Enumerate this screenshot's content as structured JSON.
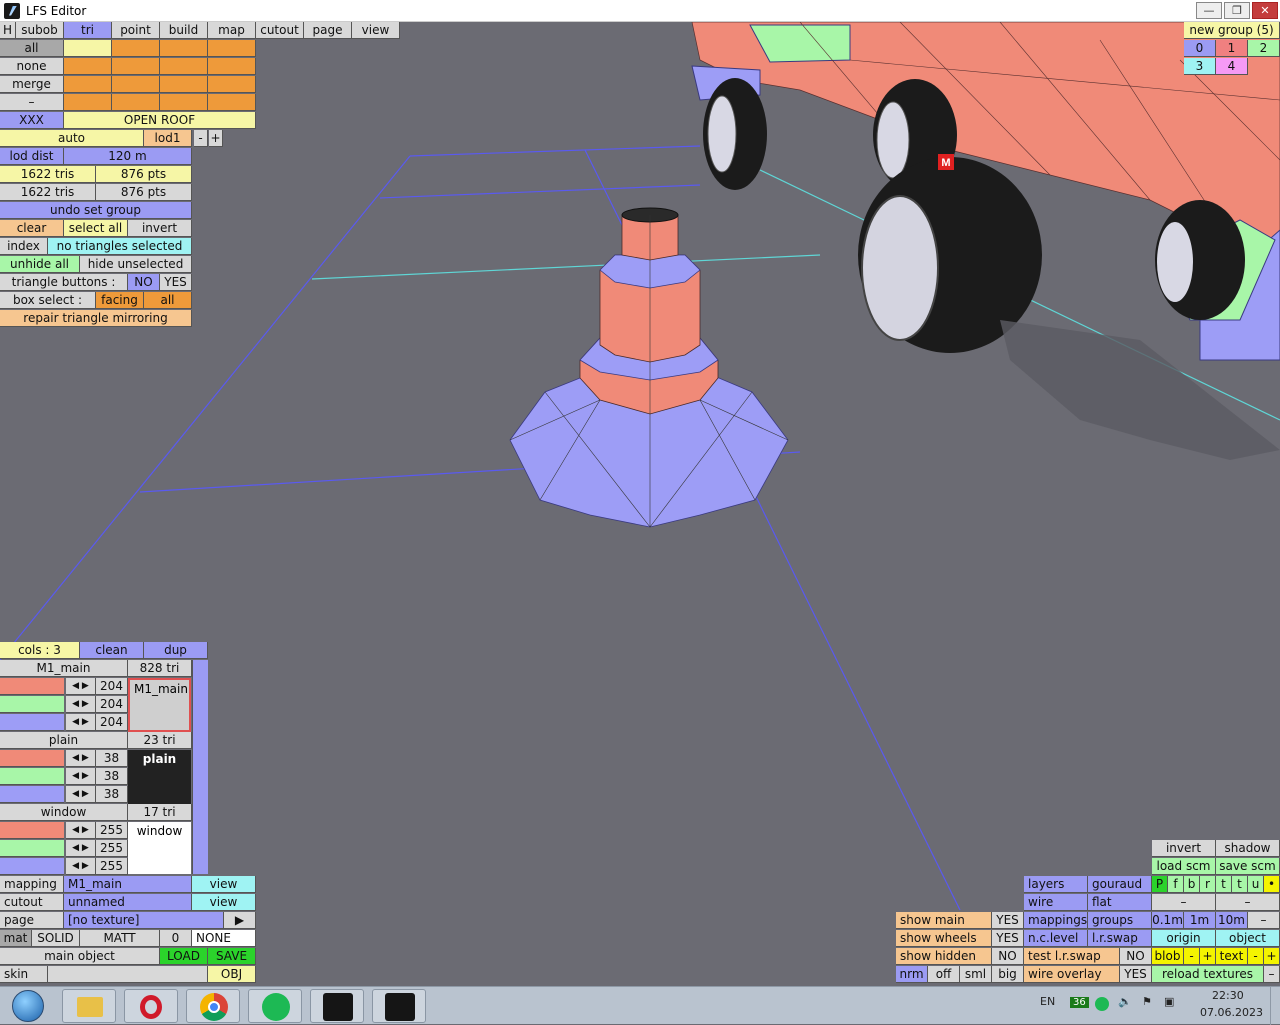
{
  "window": {
    "title": "LFS Editor",
    "min": "—",
    "max": "❐",
    "close": "✕"
  },
  "menu": {
    "h": "H",
    "items": [
      "subob",
      "tri",
      "point",
      "build",
      "map",
      "cutout",
      "page",
      "view"
    ]
  },
  "sel": {
    "all": "all",
    "none": "none",
    "merge": "merge",
    "dash": "–",
    "xxx": "XXX",
    "open_roof": "OPEN ROOF"
  },
  "lod": {
    "auto": "auto",
    "lod1": "lod1",
    "minus": "-",
    "plus": "+",
    "dist_label": "lod dist",
    "dist": "120 m"
  },
  "counts": {
    "tris1": "1622 tris",
    "pts1": "876 pts",
    "tris2": "1622 tris",
    "pts2": "876 pts"
  },
  "actions": {
    "undo": "undo set group",
    "clear": "clear",
    "select_all": "select all",
    "invert": "invert",
    "index": "index",
    "index_value": "no triangles selected",
    "unhide": "unhide all",
    "hide_unsel": "hide unselected",
    "tri_buttons": "triangle buttons :",
    "no": "NO",
    "yes": "YES",
    "box_select": "box select :",
    "facing": "facing",
    "all": "all",
    "repair": "repair triangle mirroring"
  },
  "group": {
    "new": "new group (5)",
    "n": [
      "0",
      "1",
      "2",
      "3",
      "4"
    ]
  },
  "cols": {
    "cols": "cols : 3",
    "clean": "clean",
    "dup": "dup"
  },
  "materials": [
    {
      "name": "M1_main",
      "tri": "828 tri",
      "vals": [
        "204",
        "204",
        "204"
      ],
      "preview": "M1_main"
    },
    {
      "name": "plain",
      "tri": "23 tri",
      "vals": [
        "38",
        "38",
        "38"
      ],
      "preview": "plain"
    },
    {
      "name": "window",
      "tri": "17 tri",
      "vals": [
        "255",
        "255",
        "255"
      ],
      "preview": "window"
    }
  ],
  "map": {
    "mapping": "mapping",
    "mapping_val": "M1_main",
    "view": "view",
    "cutout": "cutout",
    "cutout_val": "unnamed",
    "page": "page",
    "page_val": "[no texture]",
    "play": "▶",
    "mat": "mat",
    "solid": "SOLID",
    "matt": "MATT",
    "zero": "0",
    "none": "NONE",
    "main_object": "main object",
    "load": "LOAD",
    "save": "SAVE",
    "skin": "skin",
    "obj": "OBJ"
  },
  "view": {
    "show_main": "show main",
    "yes": "YES",
    "show_wheels": "show wheels",
    "show_hidden": "show hidden",
    "no": "NO",
    "nrm": "nrm",
    "off": "off",
    "sml": "sml",
    "big": "big",
    "layers": "layers",
    "gouraud": "gouraud",
    "wire": "wire",
    "flat": "flat",
    "mappings": "mappings",
    "groups": "groups",
    "nc_level": "n.c.level",
    "lr_swap": "l.r.swap",
    "test_lr": "test l.r.swap",
    "wire_overlay": "wire overlay",
    "invert": "invert",
    "shadow": "shadow",
    "load_scm": "load scm",
    "save_scm": "save scm",
    "pf": [
      "P",
      "f",
      "b",
      "r",
      "t",
      "t",
      "u",
      "•"
    ],
    "dash": "–",
    "d01": "0.1m",
    "d1": "1m",
    "d10": "10m",
    "origin": "origin",
    "object": "object",
    "blob": "blob",
    "text": "text",
    "minus": "-",
    "plus": "+",
    "reload": "reload textures"
  },
  "taskbar": {
    "lang": "EN",
    "time": "22:30",
    "date": "07.06.2023",
    "badge": "36"
  },
  "marker": "M"
}
